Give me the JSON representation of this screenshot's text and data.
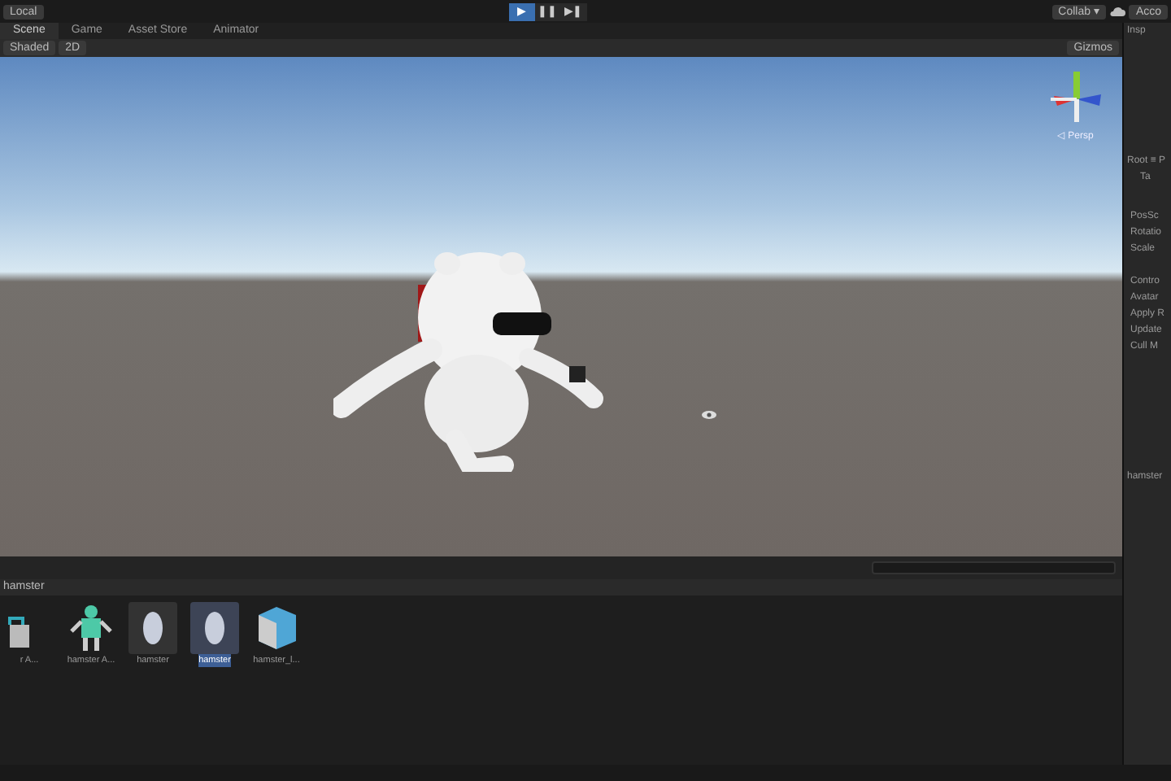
{
  "toolbar": {
    "pivot": "Local",
    "play_buttons": [
      {
        "glyph": "▶",
        "selected": true
      },
      {
        "glyph": "❚❚",
        "selected": false
      },
      {
        "glyph": "▶❚",
        "selected": false
      }
    ],
    "collab": "Collab ▾",
    "account": "Acco"
  },
  "scene_tabs": [
    {
      "label": "Scene",
      "selected": true
    },
    {
      "label": "Game",
      "selected": false
    },
    {
      "label": "Asset Store",
      "selected": false
    },
    {
      "label": "Animator",
      "selected": false
    }
  ],
  "scene_toolbar": {
    "shading": "Shaded",
    "mode_2d": "2D",
    "gizmos": "Gizmos"
  },
  "viewport": {
    "projection": "◁ Persp"
  },
  "inspector": {
    "tab": "Insp",
    "section": "Root ≡ P",
    "tag": "Ta",
    "transform_fields": [
      "PosSc",
      "Rotatio",
      "Scale"
    ],
    "animator_fields": [
      "Contro",
      "Avatar",
      "Apply R",
      "Update",
      "Cull M"
    ],
    "footer": "hamster"
  },
  "project": {
    "breadcrumb": "hamster",
    "assets": [
      {
        "kind": "controller",
        "label": "r A...",
        "selected": false
      },
      {
        "kind": "avatar",
        "label": "hamster A...",
        "selected": false
      },
      {
        "kind": "model",
        "label": "hamster",
        "selected": false
      },
      {
        "kind": "model",
        "label": "hamster",
        "selected": true
      },
      {
        "kind": "prefab",
        "label": "hamster_l...",
        "selected": false
      }
    ]
  }
}
